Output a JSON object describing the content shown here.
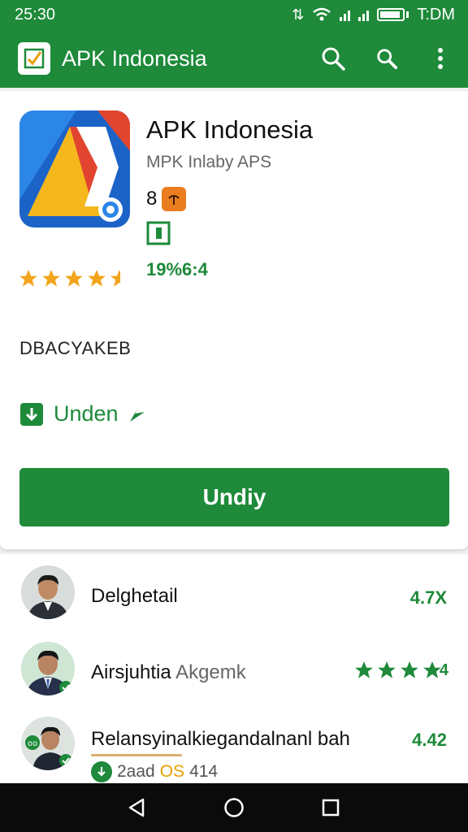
{
  "status": {
    "time": "25:30",
    "right_time": "T:DM"
  },
  "appbar": {
    "title": "APK Indonesia"
  },
  "app": {
    "name": "APK Indonesia",
    "developer": "MPK Inlaby APS",
    "age_rating": "8",
    "downloads": "19%6:4",
    "rating_stars": 4.5
  },
  "section": {
    "label": "DBACYAKEB"
  },
  "update_link": {
    "label": "Unden"
  },
  "primary_button": {
    "label": "Undiy"
  },
  "reviews": [
    {
      "name": "Delghetail",
      "sub": "",
      "rating": "4.7X"
    },
    {
      "name": "Airsjuhtia",
      "sub": "Akgemk",
      "stars": 4,
      "stars_suffix": "4"
    },
    {
      "name": "Relansyinalkiegandalnanl bah",
      "sub": "",
      "rating": "4.42",
      "meta_text": "2aad",
      "meta_accent": "OS",
      "meta_tail": "414"
    }
  ],
  "colors": {
    "primary": "#1e8a3a",
    "star": "#f2a51c",
    "age_badge": "#ea7d20"
  },
  "icons": [
    "search-icon",
    "search-icon-2",
    "more-vert-icon",
    "download-icon",
    "back-icon",
    "home-icon",
    "recents-icon"
  ]
}
